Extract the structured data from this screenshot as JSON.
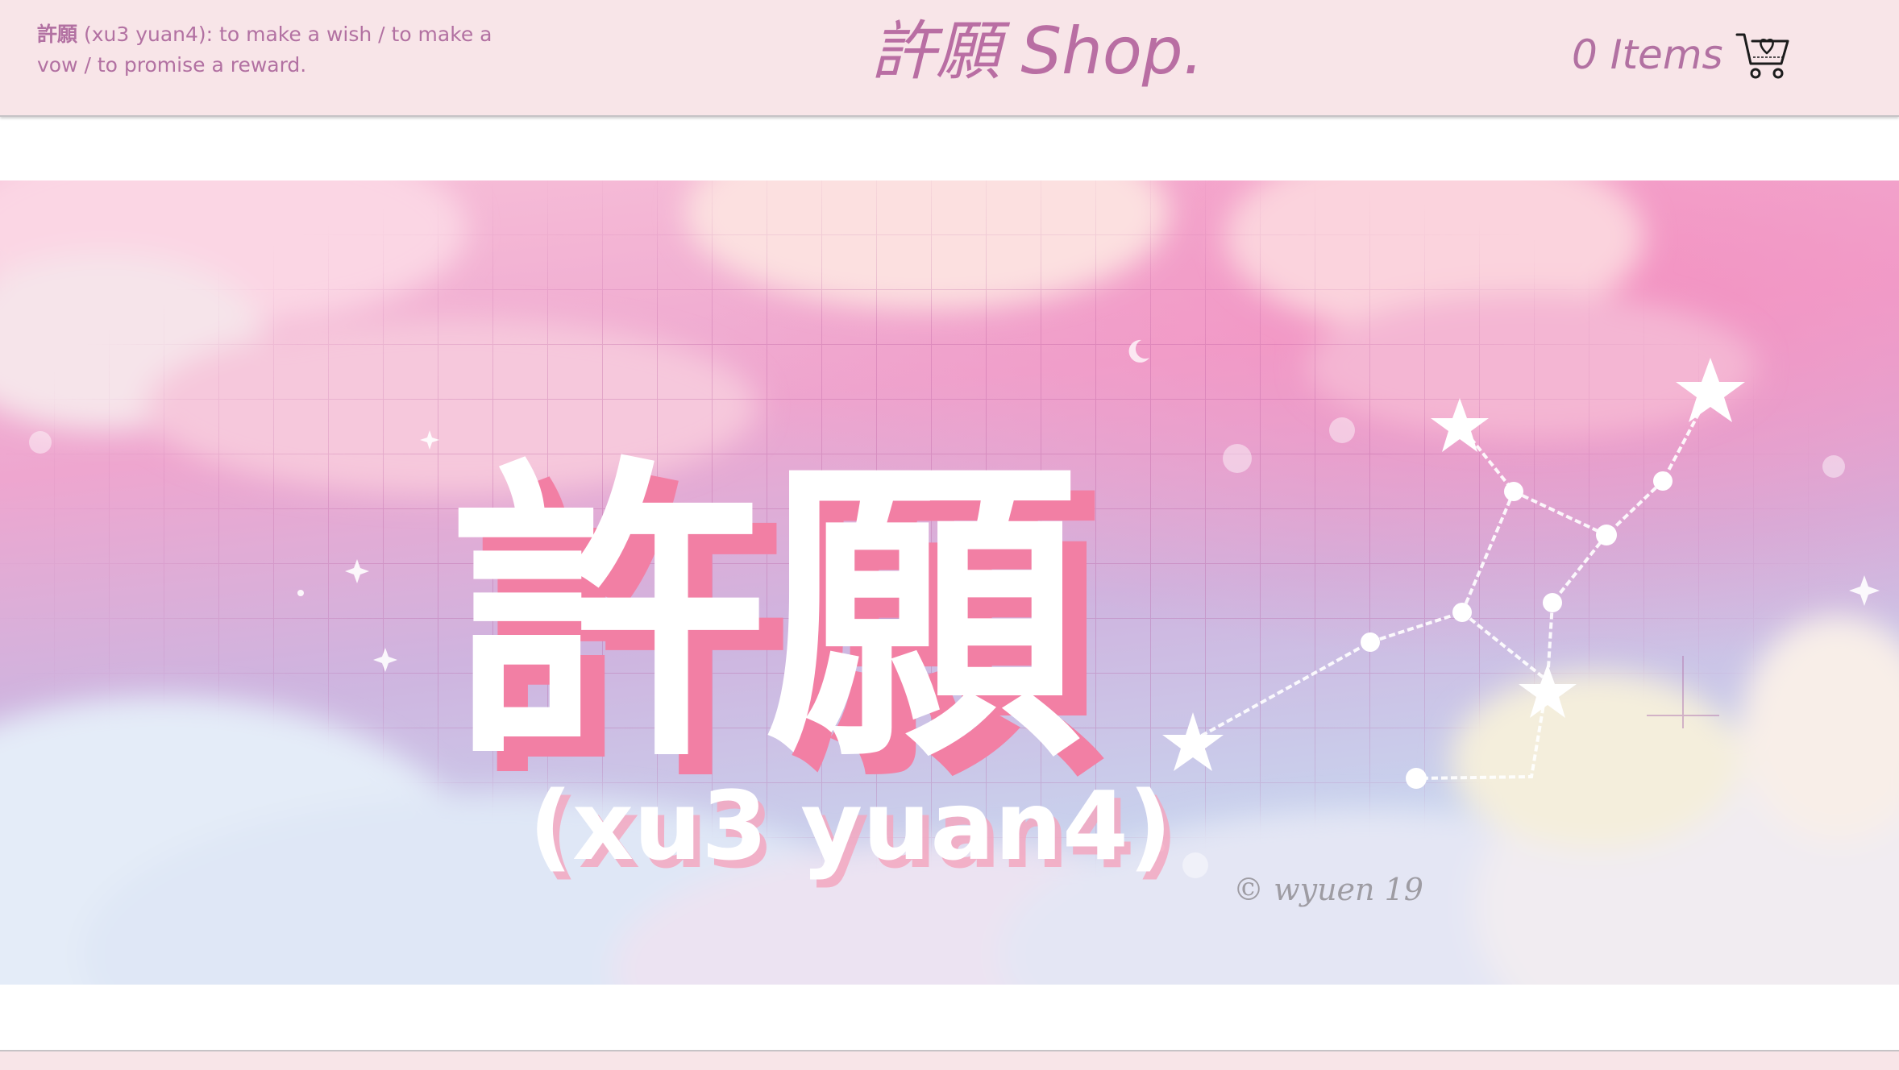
{
  "header": {
    "tagline_hanzi": "許願",
    "tagline_rest": " (xu3 yuan4): to make a wish / to make a vow / to promise a reward.",
    "brand": "許願 Shop.",
    "cart_count": "0 Items",
    "cart_icon": "cart-heart-icon"
  },
  "hero": {
    "hanzi": "許願",
    "pinyin": "(xu3 yuan4)",
    "signature": "© wyuen 19"
  },
  "colors": {
    "header_bg": "#f8e5e8",
    "accent": "#b96ea3",
    "hanzi_shadow": "#f27fa4"
  }
}
